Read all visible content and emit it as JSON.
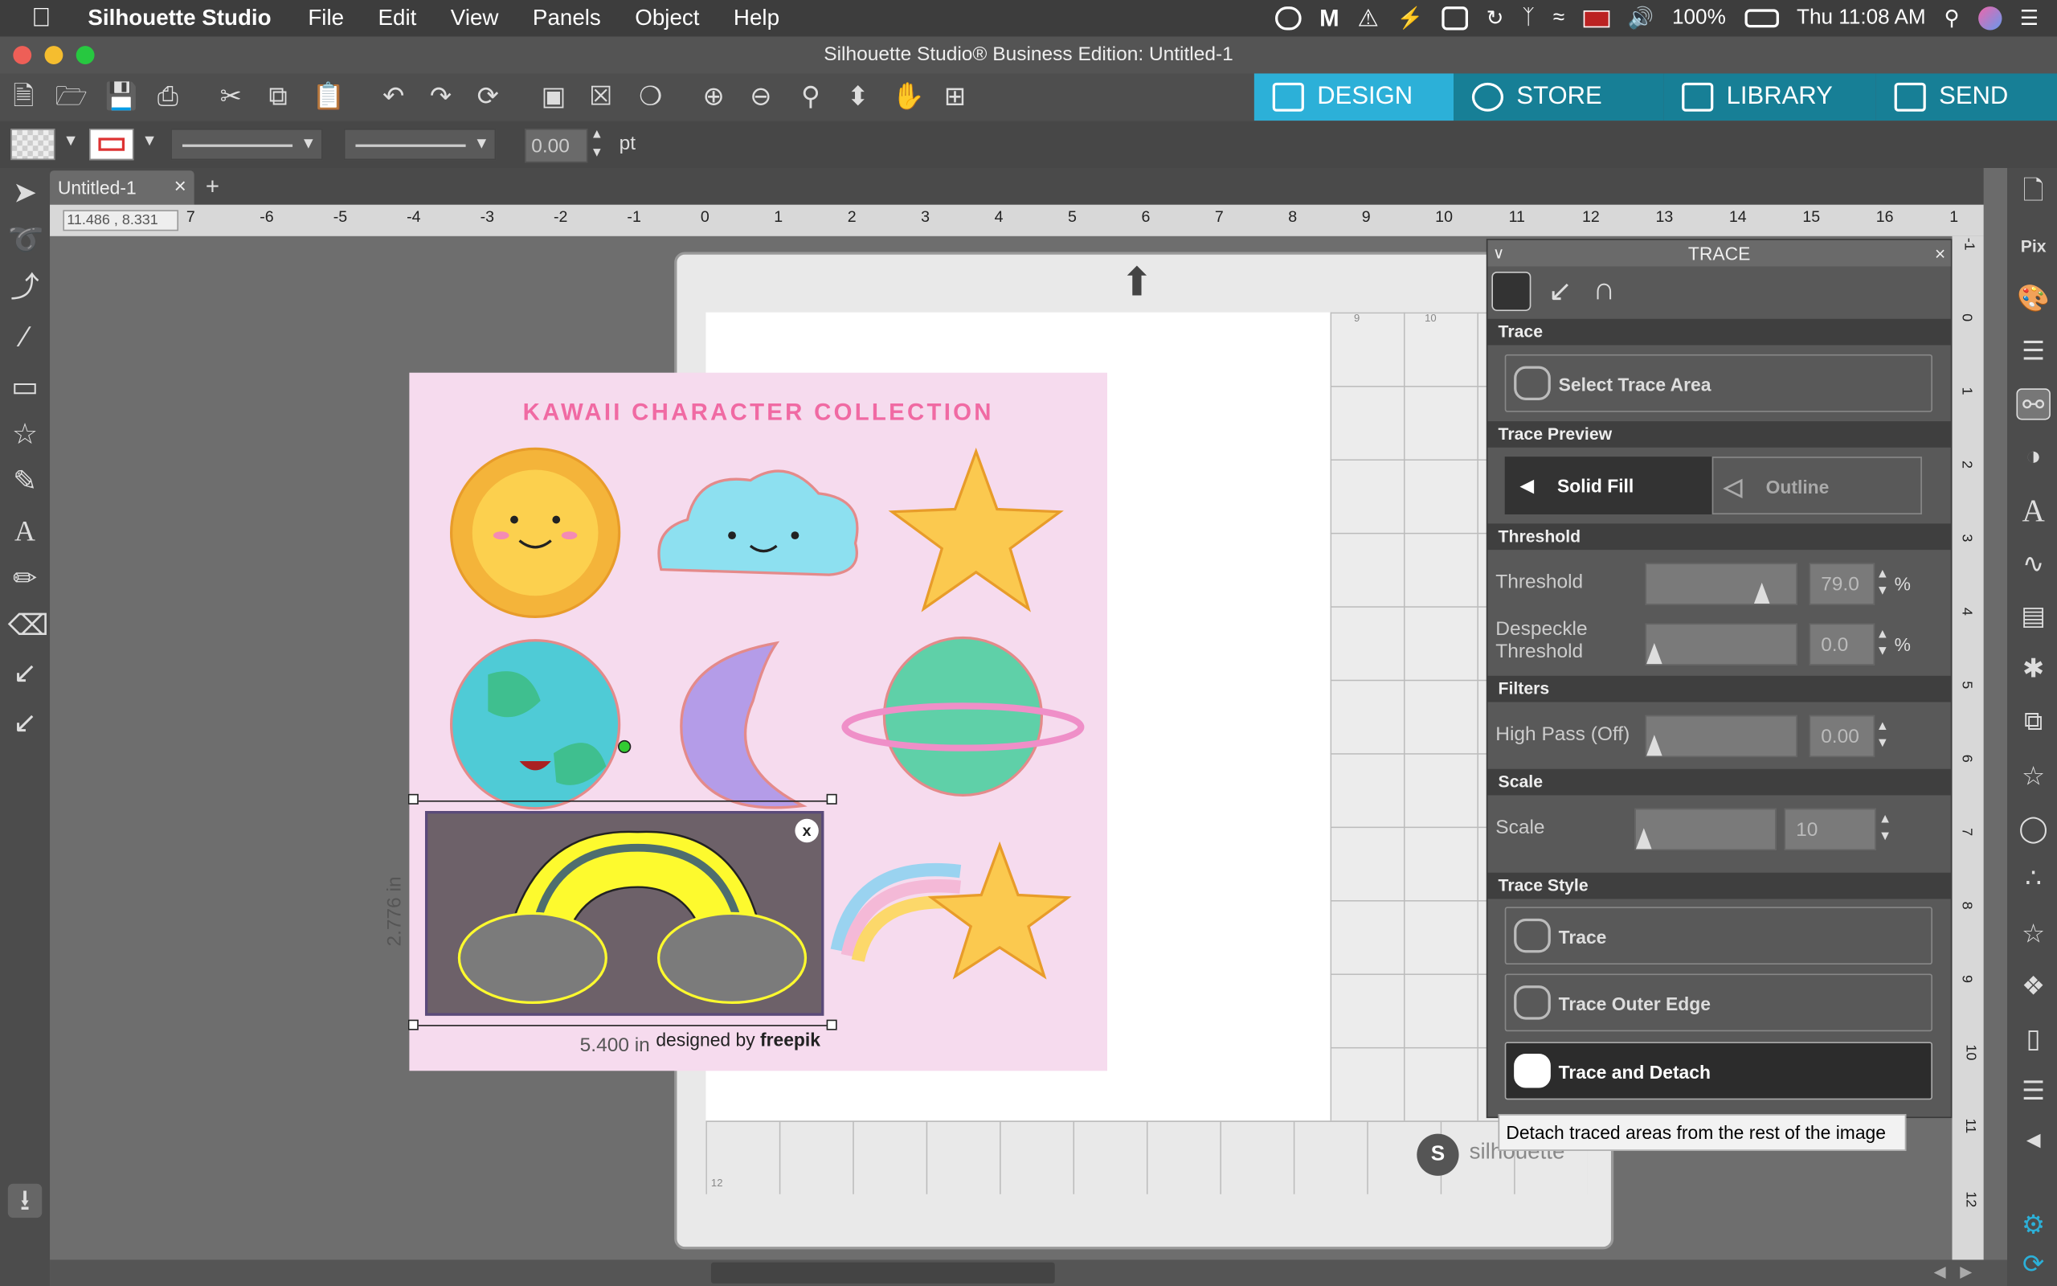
{
  "menubar": {
    "app_name": "Silhouette Studio",
    "items": [
      "File",
      "Edit",
      "View",
      "Panels",
      "Object",
      "Help"
    ],
    "battery": "100%",
    "clock": "Thu 11:08 AM"
  },
  "window": {
    "title": "Silhouette Studio® Business Edition: Untitled-1"
  },
  "nav_tabs": [
    {
      "label": "DESIGN",
      "color": "#2cb0d8"
    },
    {
      "label": "STORE",
      "color": "#177f96"
    },
    {
      "label": "LIBRARY",
      "color": "#177f96"
    },
    {
      "label": "SEND",
      "color": "#177f96"
    }
  ],
  "propbar": {
    "line_width": "0.00",
    "unit": "pt"
  },
  "doc_tab": {
    "label": "Untitled-1",
    "close": "×",
    "add": "+"
  },
  "ruler": {
    "coords": "11.486 , 8.331",
    "h_ticks": [
      "7",
      "-6",
      "-5",
      "-4",
      "-3",
      "-2",
      "-1",
      "0",
      "1",
      "2",
      "3",
      "4",
      "5",
      "6",
      "7",
      "8",
      "9",
      "10",
      "11",
      "12",
      "13",
      "14",
      "15",
      "16",
      "1"
    ],
    "v_ticks": [
      "-1",
      "0",
      "1",
      "2",
      "3",
      "4",
      "5",
      "6",
      "7",
      "8",
      "9",
      "10",
      "11",
      "12"
    ]
  },
  "artwork": {
    "title": "KAWAII CHARACTER COLLECTION",
    "credit": "designed by",
    "credit_brand": "freepik"
  },
  "selection": {
    "width": "5.400 in",
    "height": "2.776 in",
    "close": "x"
  },
  "mat": {
    "brand": "silhouette",
    "small_nums": [
      "9",
      "10",
      "12"
    ]
  },
  "trace_panel": {
    "title": "TRACE",
    "sections": {
      "trace": "Trace",
      "preview": "Trace Preview",
      "threshold": "Threshold",
      "filters": "Filters",
      "scale": "Scale",
      "style": "Trace Style"
    },
    "select_area": "Select Trace Area",
    "preview_solid": "Solid Fill",
    "preview_outline": "Outline",
    "threshold_label": "Threshold",
    "threshold_value": "79.0",
    "threshold_unit": "%",
    "threshold_level": 0.79,
    "despeckle_label_1": "Despeckle",
    "despeckle_label_2": "Threshold",
    "despeckle_value": "0.0",
    "despeckle_unit": "%",
    "highpass_label": "High Pass (Off)",
    "highpass_value": "0.00",
    "scale_label": "Scale",
    "scale_value": "10",
    "btn_trace": "Trace",
    "btn_outer": "Trace Outer Edge",
    "btn_detach": "Trace and Detach"
  },
  "tooltip": "Detach traced areas from the rest of the image"
}
